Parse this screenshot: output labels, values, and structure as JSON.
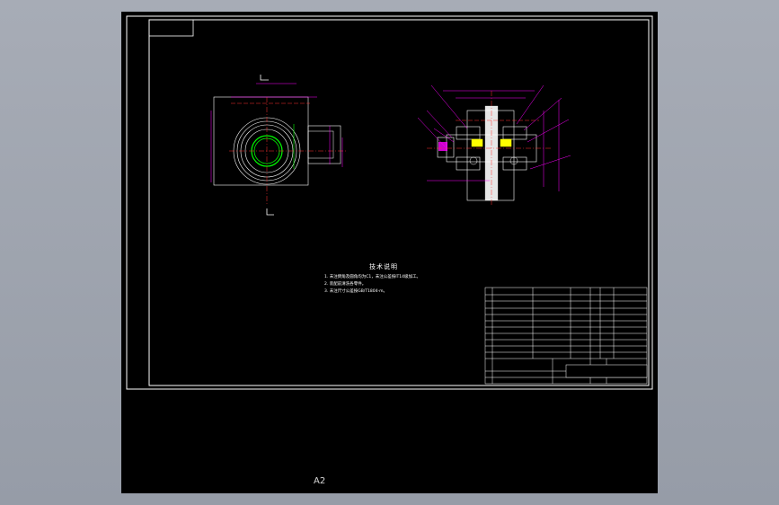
{
  "sheet": {
    "size_label": "A2"
  },
  "technical_requirements": {
    "title": "技术说明",
    "notes": [
      "1. 未注倒角及圆角均为C1，未注公差按IT14级加工。",
      "2. 装配前清洗各零件。",
      "3. 未注尺寸公差按GB/T1804-m。"
    ]
  },
  "colors": {
    "background": "#000000",
    "frame": "#ffffff",
    "dimension": "#ff00ff",
    "part_outline": "#ffffff",
    "center_line": "#ff3333",
    "highlight": "#00ff00",
    "cutting_plane": "#ffff00"
  }
}
